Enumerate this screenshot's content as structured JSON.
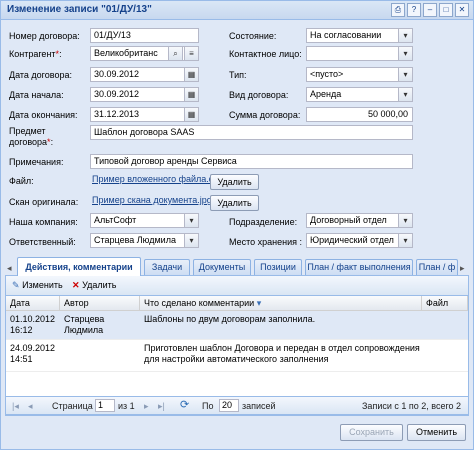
{
  "window": {
    "title": "Изменение записи \"01/ДУ/13\""
  },
  "form": {
    "number_label": "Номер договора:",
    "number_value": "01/ДУ/13",
    "contractor_label": "Контрагент",
    "contractor_value": "Великобританс",
    "contract_date_label": "Дата договора:",
    "contract_date_value": "30.09.2012",
    "start_date_label": "Дата начала:",
    "start_date_value": "30.09.2012",
    "end_date_label": "Дата окончания:",
    "end_date_value": "31.12.2013",
    "subject_label_1": "Предмет",
    "subject_label_2": "договора",
    "subject_value": "Шаблон договора SAAS",
    "notes_label": "Примечания:",
    "notes_value": "Типовой договор аренды Сервиса",
    "file_label": "Файл:",
    "file_link": "Пример вложенного файла.do",
    "scan_label": "Скан оригинала:",
    "scan_link": "Пример скана документа.jpg",
    "delete_label": "Удалить",
    "company_label": "Наша компания:",
    "company_value": "АльтСофт",
    "responsible_label": "Ответственный:",
    "responsible_value": "Старцева Людмила",
    "state_label": "Состояние:",
    "state_value": "На согласовании",
    "contact_label": "Контактное лицо:",
    "contact_value": "",
    "type_label": "Тип:",
    "type_value": "<пусто>",
    "kind_label": "Вид договора:",
    "kind_value": "Аренда",
    "sum_label": "Сумма договора:",
    "sum_value": "50 000,00",
    "division_label": "Подразделение:",
    "division_value": "Договорный отдел",
    "storage_label": "Место хранения :",
    "storage_value": "Юридический отдел",
    "required_mark": "*"
  },
  "tabs": [
    {
      "label": "Действия, комментарии"
    },
    {
      "label": "Задачи"
    },
    {
      "label": "Документы"
    },
    {
      "label": "Позиции"
    },
    {
      "label": "План / факт выполнения"
    },
    {
      "label": "План / ф"
    }
  ],
  "toolbar": {
    "edit_label": "Изменить",
    "delete_label": "Удалить"
  },
  "grid": {
    "columns": [
      "Дата",
      "Автор",
      "Что сделано комментарии",
      "Файл"
    ],
    "rows": [
      {
        "date": "01.10.2012",
        "time": "16:12",
        "author_1": "Старцева",
        "author_2": "Людмила",
        "comment_1": "Шаблоны по двум договорам заполнила.",
        "comment_2": ""
      },
      {
        "date": "24.09.2012",
        "time": "14:51",
        "author_1": "",
        "author_2": "",
        "comment_1": "Приготовлен шаблон Договора и передан в отдел сопровождения",
        "comment_2": "для настройки автоматического заполнения"
      }
    ]
  },
  "pager": {
    "page_label": "Страница",
    "page_value": "1",
    "of_label": "из 1",
    "per_page_prefix": "По",
    "per_page_value": "20",
    "per_page_suffix": "записей",
    "summary": "Записи с 1 по 2, всего 2"
  },
  "footer": {
    "save_label": "Сохранить",
    "cancel_label": "Отменить"
  },
  "colors": {
    "accent": "#15428b",
    "border": "#99bbe8",
    "background": "#dfe8f6",
    "required": "#cc0000"
  }
}
